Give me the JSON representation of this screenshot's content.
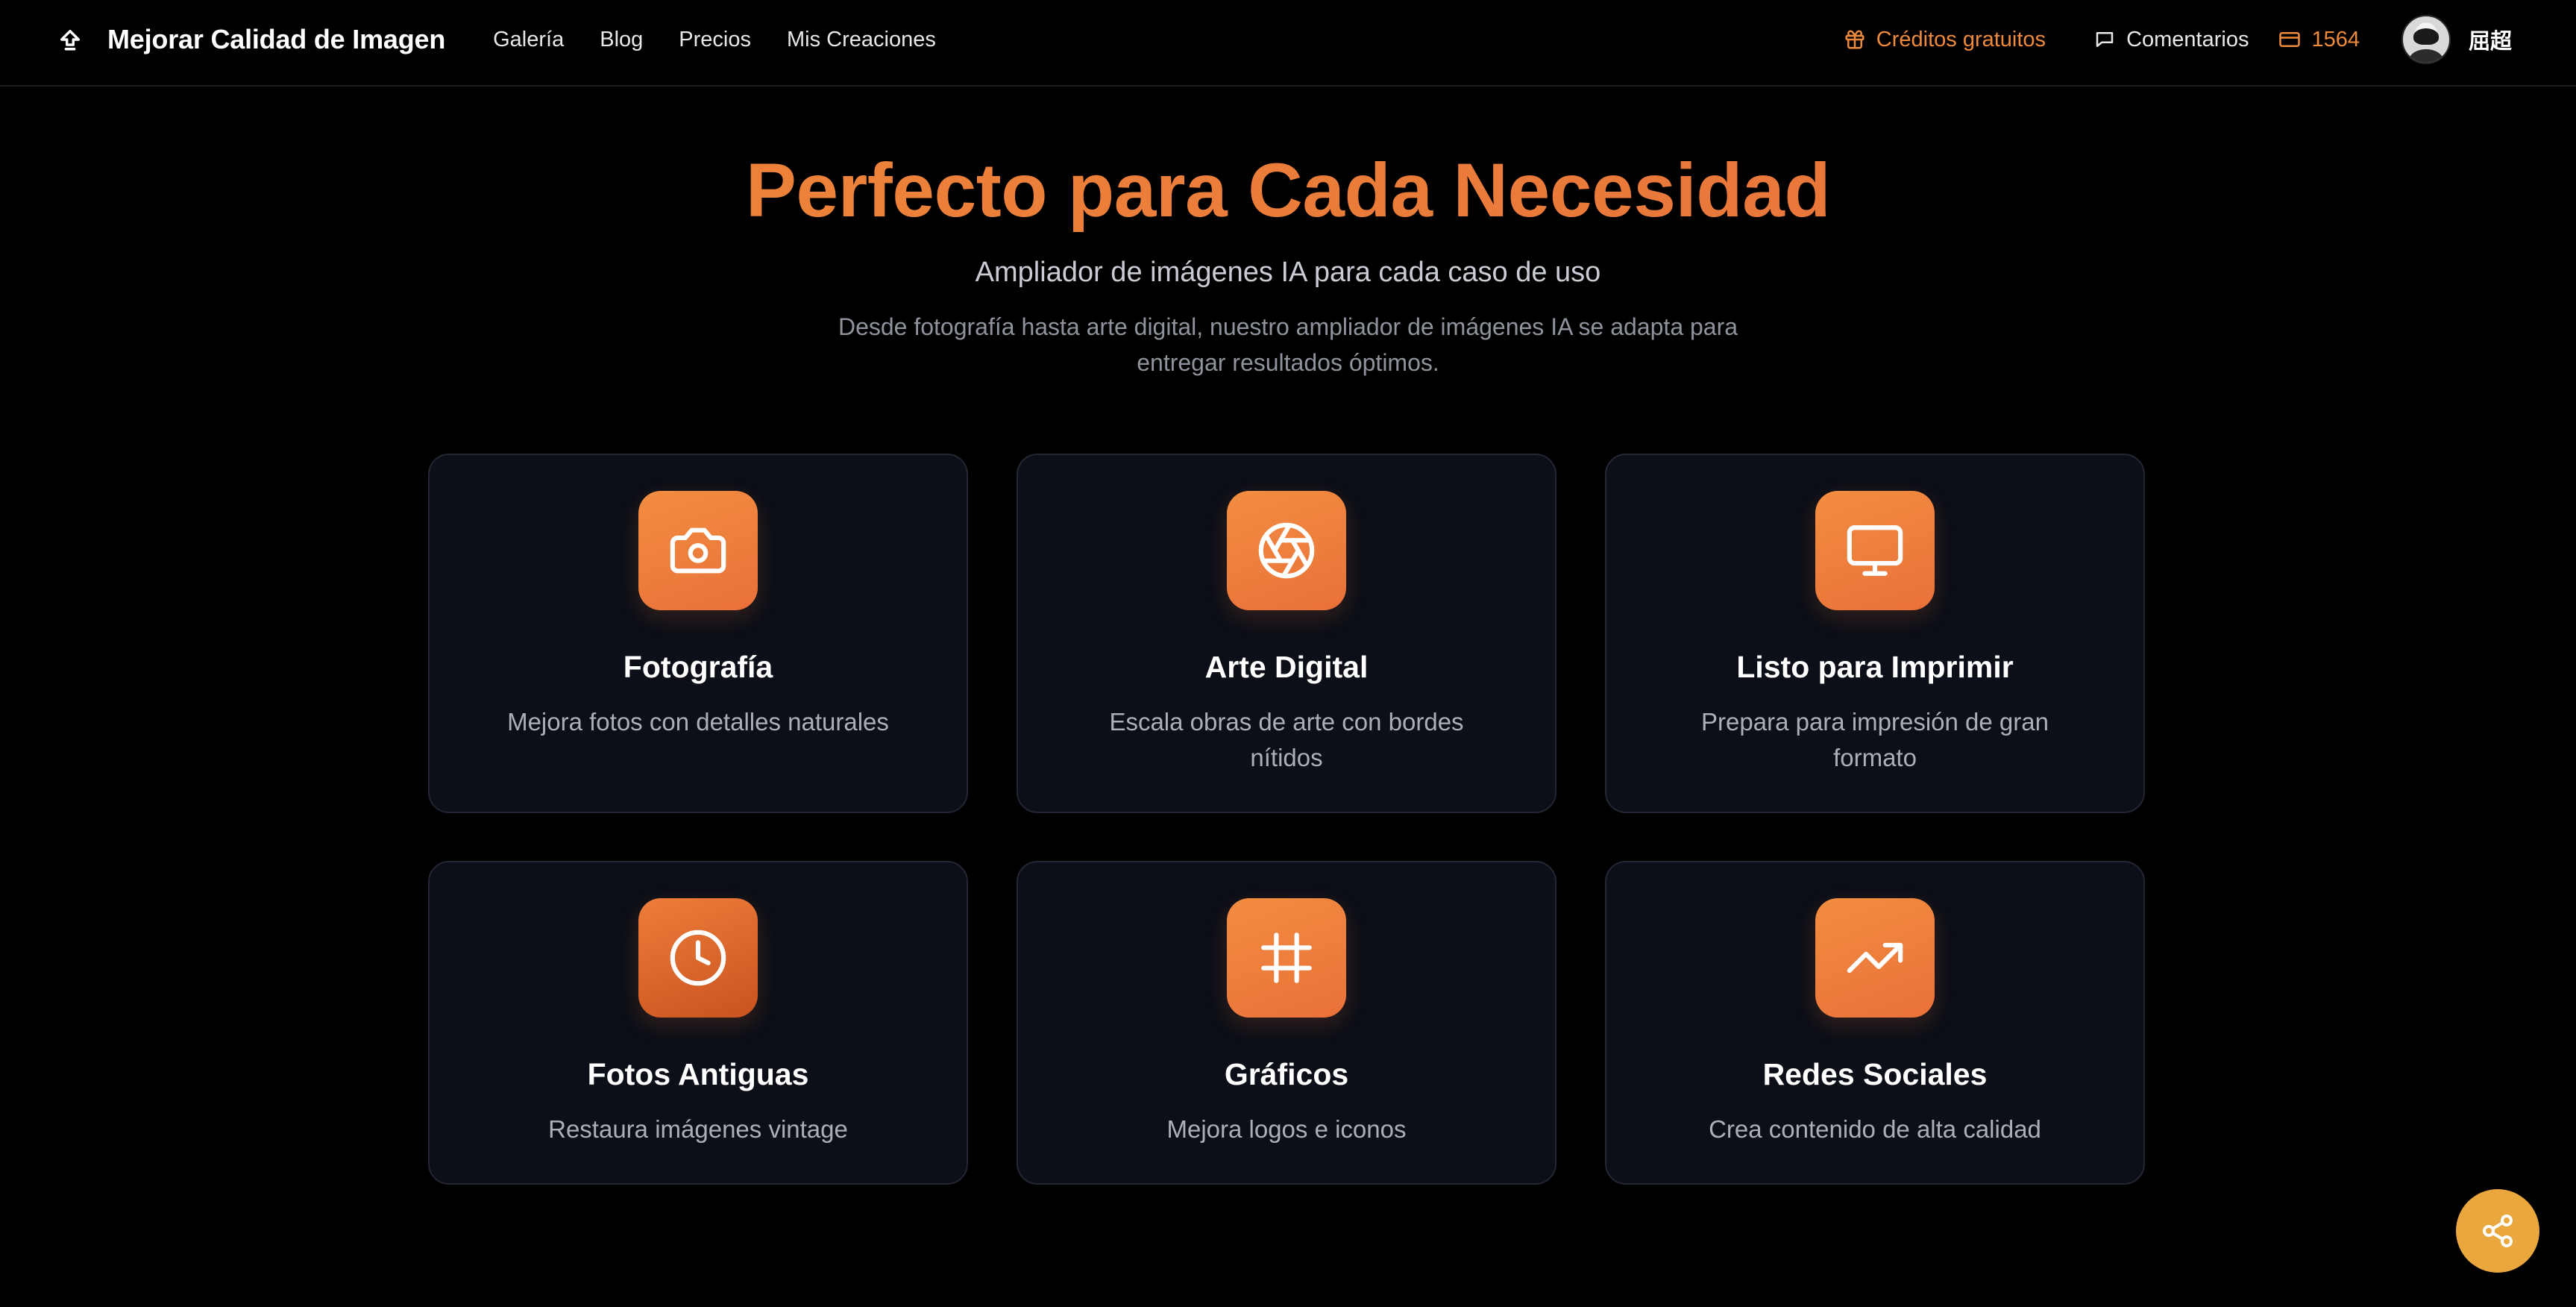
{
  "header": {
    "brand": "Mejorar Calidad de Imagen",
    "nav": [
      "Galería",
      "Blog",
      "Precios",
      "Mis Creaciones"
    ],
    "credits_link": "Créditos gratuitos",
    "comments_link": "Comentarios",
    "balance": "1564",
    "username": "屈超"
  },
  "hero": {
    "title": "Perfecto para Cada Necesidad",
    "subtitle": "Ampliador de imágenes IA para cada caso de uso",
    "description": "Desde fotografía hasta arte digital, nuestro ampliador de imágenes IA se adapta para entregar resultados óptimos."
  },
  "cards": [
    {
      "icon": "camera-icon",
      "title": "Fotografía",
      "text": "Mejora fotos con detalles naturales"
    },
    {
      "icon": "aperture-icon",
      "title": "Arte Digital",
      "text": "Escala obras de arte con bordes nítidos"
    },
    {
      "icon": "monitor-icon",
      "title": "Listo para Imprimir",
      "text": "Prepara para impresión de gran formato"
    },
    {
      "icon": "clock-icon",
      "title": "Fotos Antiguas",
      "text": "Restaura imágenes vintage"
    },
    {
      "icon": "hash-icon",
      "title": "Gráficos",
      "text": "Mejora logos e iconos"
    },
    {
      "icon": "trending-up-icon",
      "title": "Redes Sociales",
      "text": "Crea contenido de alta calidad"
    }
  ],
  "colors": {
    "accent": "#ec7d38",
    "card_bg": "#0c0f17",
    "page_bg": "#000000",
    "share_button": "#e9a73e"
  }
}
